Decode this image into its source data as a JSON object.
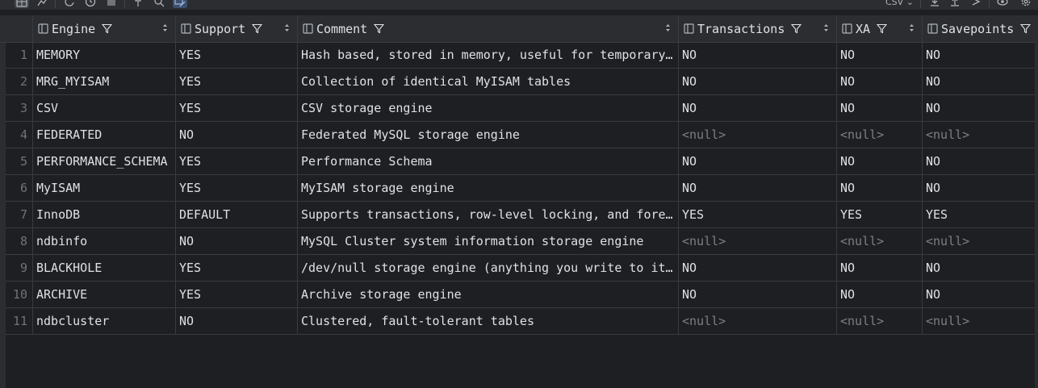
{
  "toolbar": {
    "buttons": [
      {
        "icon": "grid-view-icon"
      },
      {
        "icon": "chart-view-icon"
      },
      {
        "icon": "refresh-icon"
      },
      {
        "icon": "history-icon"
      },
      {
        "icon": "stop-icon"
      },
      {
        "icon": "pin-icon"
      },
      {
        "icon": "search-icon"
      },
      {
        "icon": "edit-mode-icon"
      }
    ],
    "export_format": "CSV",
    "right_buttons": [
      {
        "icon": "download-icon"
      },
      {
        "icon": "upload-icon"
      },
      {
        "icon": "compare-icon"
      },
      {
        "icon": "view-icon"
      },
      {
        "icon": "settings-icon"
      }
    ]
  },
  "table": {
    "columns": [
      "Engine",
      "Support",
      "Comment",
      "Transactions",
      "XA",
      "Savepoints"
    ],
    "rows": [
      {
        "num": "1",
        "cells": [
          "MEMORY",
          "YES",
          "Hash based, stored in memory, useful for temporary…",
          "NO",
          "NO",
          "NO"
        ]
      },
      {
        "num": "2",
        "cells": [
          "MRG_MYISAM",
          "YES",
          "Collection of identical MyISAM tables",
          "NO",
          "NO",
          "NO"
        ]
      },
      {
        "num": "3",
        "cells": [
          "CSV",
          "YES",
          "CSV storage engine",
          "NO",
          "NO",
          "NO"
        ]
      },
      {
        "num": "4",
        "cells": [
          "FEDERATED",
          "NO",
          "Federated MySQL storage engine",
          "<null>",
          "<null>",
          "<null>"
        ]
      },
      {
        "num": "5",
        "cells": [
          "PERFORMANCE_SCHEMA",
          "YES",
          "Performance Schema",
          "NO",
          "NO",
          "NO"
        ]
      },
      {
        "num": "6",
        "cells": [
          "MyISAM",
          "YES",
          "MyISAM storage engine",
          "NO",
          "NO",
          "NO"
        ]
      },
      {
        "num": "7",
        "cells": [
          "InnoDB",
          "DEFAULT",
          "Supports transactions, row-level locking, and fore…",
          "YES",
          "YES",
          "YES"
        ]
      },
      {
        "num": "8",
        "cells": [
          "ndbinfo",
          "NO",
          "MySQL Cluster system information storage engine",
          "<null>",
          "<null>",
          "<null>"
        ]
      },
      {
        "num": "9",
        "cells": [
          "BLACKHOLE",
          "YES",
          "/dev/null storage engine (anything you write to it…",
          "NO",
          "NO",
          "NO"
        ]
      },
      {
        "num": "10",
        "cells": [
          "ARCHIVE",
          "YES",
          "Archive storage engine",
          "NO",
          "NO",
          "NO"
        ]
      },
      {
        "num": "11",
        "cells": [
          "ndbcluster",
          "NO",
          "Clustered, fault-tolerant tables",
          "<null>",
          "<null>",
          "<null>"
        ]
      }
    ]
  },
  "colors": {
    "background": "#1e1f22",
    "header_bg": "#2b2d30",
    "grid_line": "#393b40",
    "text": "#dfe1e5",
    "null_text": "#7c7f85",
    "row_number": "#6f737a"
  }
}
